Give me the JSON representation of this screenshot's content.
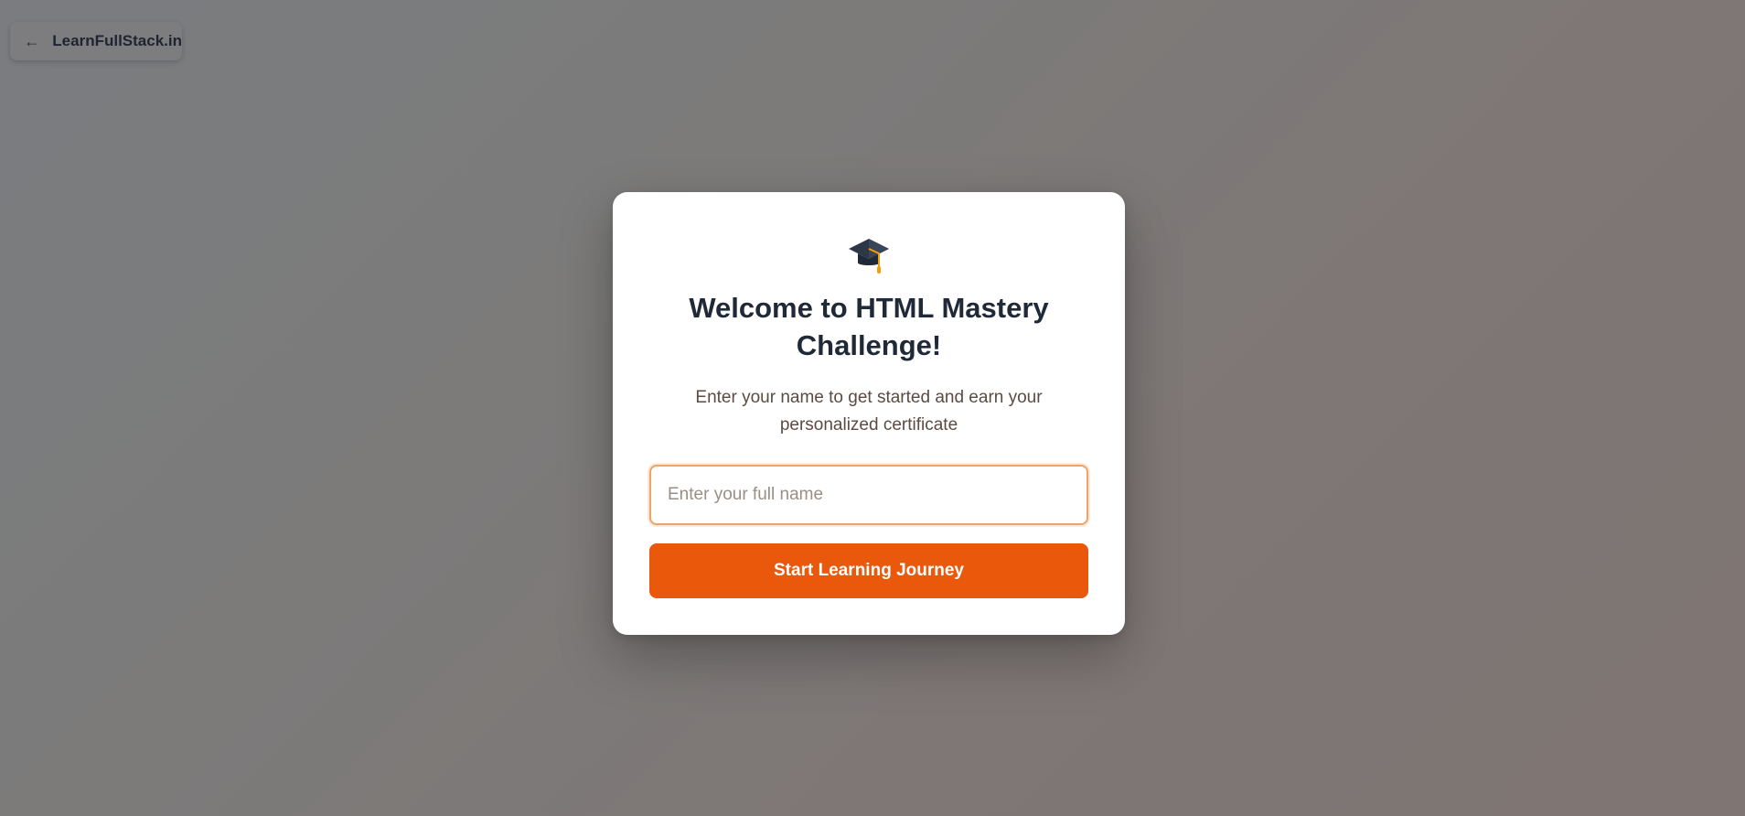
{
  "back_link": {
    "arrow": "←",
    "label": "LearnFullStack.in"
  },
  "modal": {
    "icon": "graduation-cap-icon",
    "title": "Welcome to HTML Mastery Challenge!",
    "subtitle": "Enter your name to get started and earn your personalized certificate",
    "name_input": {
      "value": "",
      "placeholder": "Enter your full name"
    },
    "start_button_label": "Start Learning Journey"
  },
  "colors": {
    "accent": "#ea580c",
    "input_focus_border": "#f0a364",
    "title_text": "#1f2937"
  }
}
